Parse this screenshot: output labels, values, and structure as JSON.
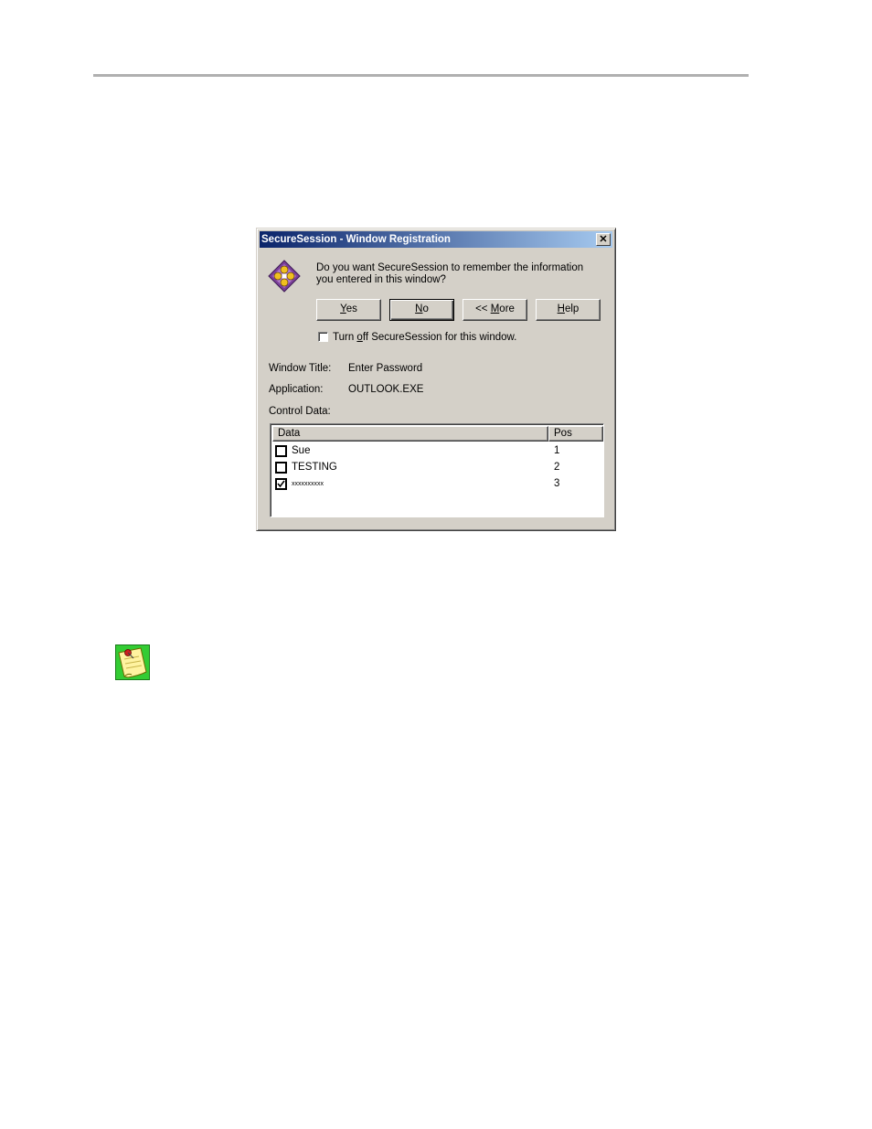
{
  "dialog": {
    "title": "SecureSession - Window Registration",
    "close_glyph": "✕",
    "app_icon": "securesession-diamond-icon",
    "prompt": "Do you want SecureSession to remember the information you entered in this window?",
    "buttons": {
      "yes": {
        "mnemonic": "Y",
        "rest": "es"
      },
      "no": {
        "mnemonic": "N",
        "rest": "o"
      },
      "more": {
        "prefix": "<< ",
        "mnemonic": "M",
        "rest": "ore"
      },
      "help": {
        "mnemonic": "H",
        "rest": "elp"
      }
    },
    "turn_off": {
      "prefix": "Turn ",
      "mnemonic": "o",
      "rest": "ff SecureSession for this window.",
      "checked": false
    },
    "window_title_label": "Window Title:",
    "window_title_value": "Enter Password",
    "application_label": "Application:",
    "application_value": "OUTLOOK.EXE",
    "control_data_label": "Control Data:",
    "list": {
      "columns": [
        "Data",
        "Pos"
      ],
      "rows": [
        {
          "data": "Sue",
          "pos": "1",
          "checked": false
        },
        {
          "data": "TESTING",
          "pos": "2",
          "checked": false
        },
        {
          "data": "xxxxxxxxxx",
          "pos": "3",
          "checked": true
        }
      ]
    }
  },
  "note_icon": "note-pin-icon",
  "colors": {
    "title_start": "#0a246a",
    "title_end": "#a6caf0",
    "face": "#d4d0c8",
    "note_green": "#33cc33"
  }
}
